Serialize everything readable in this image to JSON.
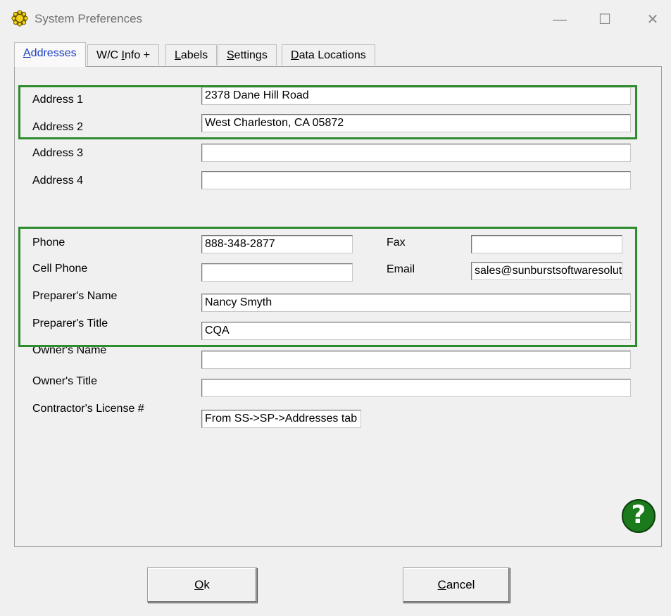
{
  "window": {
    "title": "System Preferences",
    "app_icon": "sun-gear-icon",
    "controls": {
      "minimize": "—",
      "maximize": "☐",
      "close": "✕"
    }
  },
  "tabs": [
    {
      "pre": "",
      "key": "A",
      "post": "ddresses",
      "active": true
    },
    {
      "pre": "W/C ",
      "key": "I",
      "post": "nfo +",
      "active": false
    },
    {
      "pre": "",
      "key": "L",
      "post": "abels",
      "active": false
    },
    {
      "pre": "",
      "key": "S",
      "post": "ettings",
      "active": false
    },
    {
      "pre": "",
      "key": "D",
      "post": "ata Locations",
      "active": false
    }
  ],
  "form": {
    "address1": {
      "label": "Address 1",
      "value": "2378 Dane Hill Road"
    },
    "address2": {
      "label": "Address 2",
      "value": "West Charleston, CA 05872"
    },
    "address3": {
      "label": "Address 3",
      "value": ""
    },
    "address4": {
      "label": "Address 4",
      "value": ""
    },
    "phone": {
      "label": "Phone",
      "value": "888-348-2877"
    },
    "fax": {
      "label": "Fax",
      "value": ""
    },
    "cell_phone": {
      "label": "Cell Phone",
      "value": ""
    },
    "email": {
      "label": "Email",
      "value": "sales@sunburstsoftwaresoluti"
    },
    "preparer_name": {
      "label": "Preparer's Name",
      "value": "Nancy Smyth"
    },
    "preparer_title": {
      "label": "Preparer's Title",
      "value": "CQA"
    },
    "owner_name": {
      "label": "Owner's Name",
      "value": ""
    },
    "owner_title": {
      "label": "Owner's Title",
      "value": ""
    },
    "contractor_license": {
      "label": "Contractor's License #",
      "value": "From SS->SP->Addresses tab"
    }
  },
  "buttons": {
    "ok": {
      "key": "O",
      "post": "k"
    },
    "cancel": {
      "key": "C",
      "post": "ancel"
    }
  },
  "help": {
    "glyph": "?",
    "icon": "help-icon"
  },
  "colors": {
    "highlight_box": "#2e8b2e",
    "help_icon": "#1b7a1b",
    "active_tab_text": "#1c3fc0"
  }
}
